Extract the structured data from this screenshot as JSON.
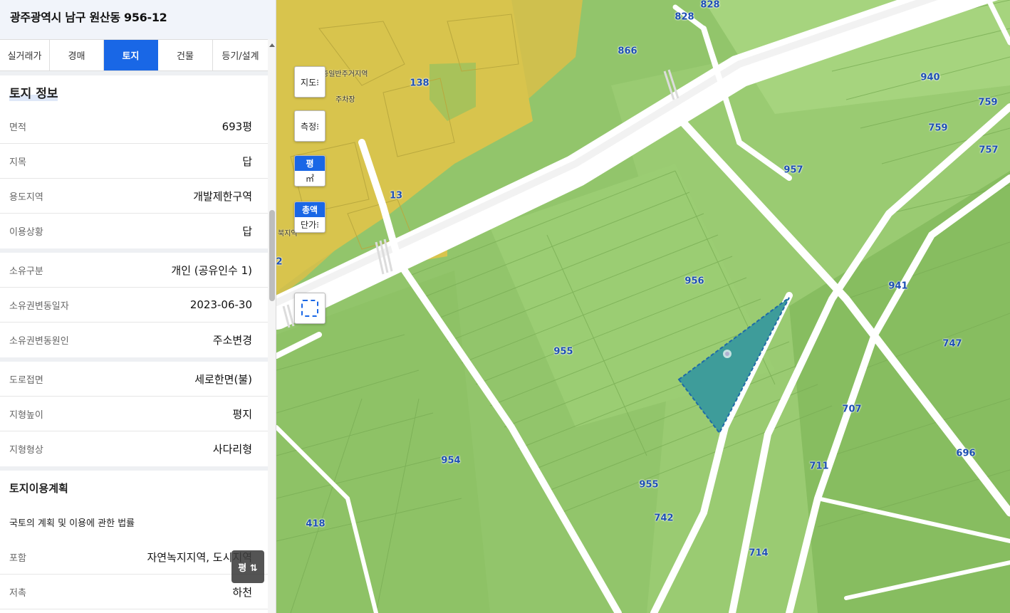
{
  "panel": {
    "address": "광주광역시 남구 원산동 956-12",
    "tabs": [
      {
        "label": "실거래가",
        "active": false
      },
      {
        "label": "경매",
        "active": false
      },
      {
        "label": "토지",
        "active": true
      },
      {
        "label": "건물",
        "active": false
      },
      {
        "label": "등기/설계",
        "active": false
      }
    ],
    "section_title": "토지 정보",
    "rows_basic": [
      {
        "label": "면적",
        "value": "693평"
      },
      {
        "label": "지목",
        "value": "답"
      },
      {
        "label": "용도지역",
        "value": "개발제한구역"
      },
      {
        "label": "이용상황",
        "value": "답"
      }
    ],
    "rows_owner": [
      {
        "label": "소유구분",
        "value": "개인 (공유인수 1)"
      },
      {
        "label": "소유권변동일자",
        "value": "2023-06-30"
      },
      {
        "label": "소유권변동원인",
        "value": "주소변경"
      }
    ],
    "rows_terrain": [
      {
        "label": "도로접면",
        "value": "세로한면(불)"
      },
      {
        "label": "지형높이",
        "value": "평지"
      },
      {
        "label": "지형형상",
        "value": "사다리형"
      }
    ],
    "plan_title": "토지이용계획",
    "plan_law": "국토의 계획 및 이용에 관한 법률",
    "rows_plan": [
      {
        "label": "포함",
        "value": "자연녹지지역, 도시지역"
      },
      {
        "label": "저촉",
        "value": "하천"
      }
    ],
    "unit_toggle": "평 ⇅"
  },
  "map": {
    "controls": {
      "map_btn": "지도⁝",
      "measure_btn": "측정⁝",
      "unit_pyeong": "평",
      "unit_m2": "㎡",
      "price_total": "총액",
      "price_unit": "단가⁝"
    },
    "parcel_labels": [
      "828",
      "828",
      "866",
      "138",
      "13",
      "940",
      "759",
      "759",
      "757",
      "957",
      "956",
      "941",
      "955",
      "747",
      "707",
      "696",
      "954",
      "711",
      "955",
      "742",
      "418",
      "714",
      "2"
    ],
    "place_labels": [
      "종일반주거지역",
      "주차장",
      "북지역"
    ],
    "colors": {
      "green": "#92c56b",
      "yellow": "#d8c44d",
      "road": "#ffffff",
      "selected": "#3e9c9a",
      "accent": "#1967e6"
    }
  }
}
